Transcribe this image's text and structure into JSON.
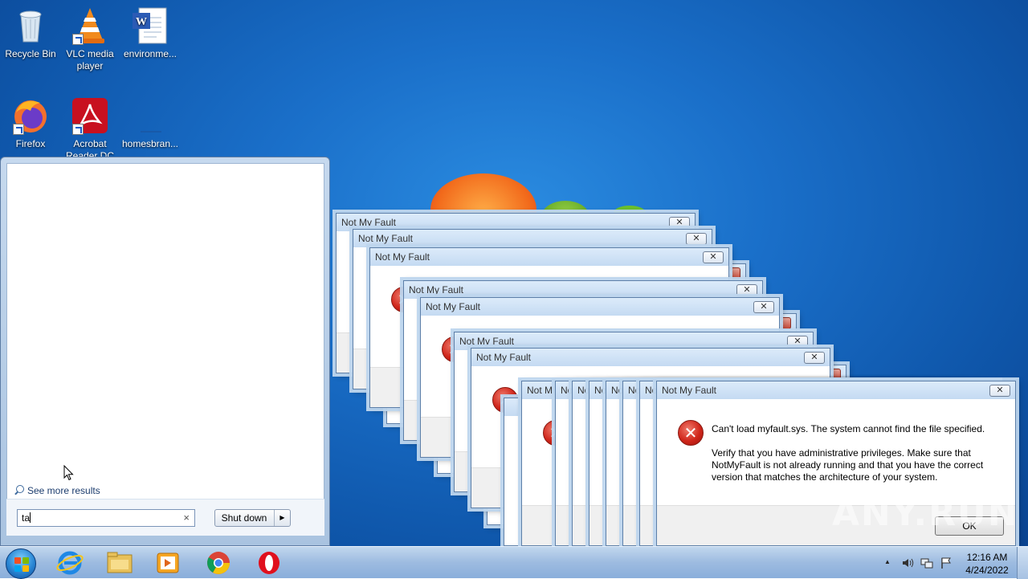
{
  "desktop": {
    "icons": [
      {
        "label": "Recycle Bin",
        "icon": "recycle-bin-icon"
      },
      {
        "label": "VLC media player",
        "icon": "vlc-icon"
      },
      {
        "label": "environme...",
        "icon": "word-document-icon"
      },
      {
        "label": "Firefox",
        "icon": "firefox-icon"
      },
      {
        "label": "Acrobat Reader DC",
        "icon": "acrobat-icon"
      },
      {
        "label": "homesbran...",
        "icon": "file-icon"
      }
    ]
  },
  "dialogs": {
    "title": "Not My Fault",
    "title_short": "Not M",
    "title_tiny": "No",
    "close_glyph": "✕",
    "error_glyph": "✕",
    "message_line1": "Can't load myfault.sys. The system cannot find the file specified.",
    "message_line2": "Verify that you have administrative privileges. Make sure that NotMyFault is not already running and that you have the correct version that matches the architecture of your system.",
    "ok_label": "OK"
  },
  "start_menu": {
    "see_more_label": "See more results",
    "search_value": "ta",
    "clear_glyph": "×",
    "shutdown_label": "Shut down",
    "shutdown_arrow": "▶"
  },
  "taskbar": {
    "apps": [
      "internet-explorer-icon",
      "file-explorer-icon",
      "media-player-icon",
      "chrome-icon",
      "opera-icon"
    ],
    "tray_up_arrow": "▲",
    "clock_time": "12:16 AM",
    "clock_date": "4/24/2022"
  },
  "watermark": "ANY.RUN",
  "colors": {
    "desktop_blue": "#1a6fc9",
    "error_red": "#d0261b",
    "dialog_title": "#dcebfa"
  }
}
